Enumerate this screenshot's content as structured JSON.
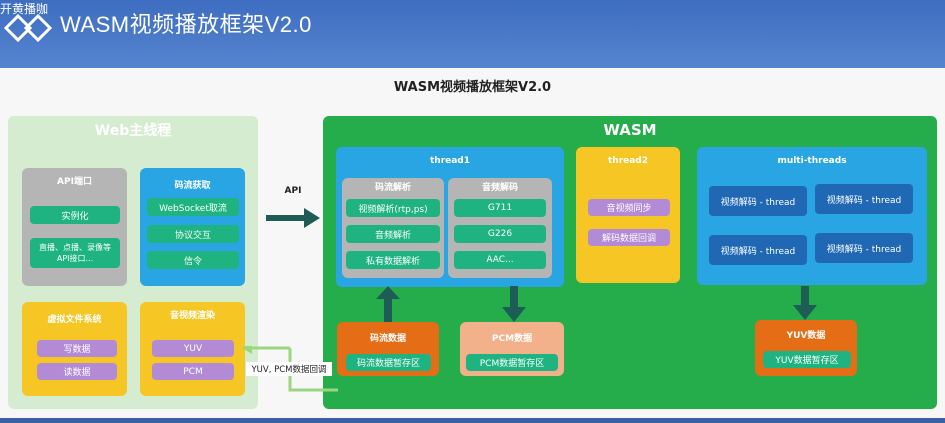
{
  "header": {
    "brand": "开黄播咖",
    "brand_sub": "",
    "title": "WASM视频播放框架V2.0"
  },
  "slide": {
    "title": "WASM视频播放框架V2.0"
  },
  "web": {
    "title": "Web主线程",
    "api_port": {
      "title": "API端口",
      "items": [
        "实例化",
        "直播、点播、录像等API接口..."
      ]
    },
    "stream_get": {
      "title": "码流获取",
      "items": [
        "WebSocket取流",
        "协议交互",
        "信令"
      ]
    },
    "vfs": {
      "title": "虚拟文件系统",
      "items": [
        "写数据",
        "读数据"
      ]
    },
    "render": {
      "title": "音视频渲染",
      "items": [
        "YUV",
        "PCM"
      ]
    }
  },
  "api_arrow_label": "API",
  "feedback_label": "YUV, PCM数据回调",
  "wasm": {
    "title": "WASM",
    "thread1": {
      "title": "thread1",
      "stream_parse": {
        "title": "码流解析",
        "items": [
          "视频解析(rtp,ps)",
          "音频解析",
          "私有数据解析"
        ]
      },
      "audio_decode": {
        "title": "音频解码",
        "items": [
          "G711",
          "G226",
          "AAC..."
        ]
      }
    },
    "thread2": {
      "title": "thread2",
      "items": [
        "音视频同步",
        "解码数据回调"
      ]
    },
    "multi": {
      "title": "multi-threads",
      "items": [
        "视频解码 - thread",
        "视频解码 - thread",
        "视频解码 - thread",
        "视频解码 - thread"
      ]
    },
    "stream_data": {
      "title": "码流数据",
      "item": "码流数据暂存区"
    },
    "pcm_data": {
      "title": "PCM数据",
      "item": "PCM数据暂存区"
    },
    "yuv_data": {
      "title": "YUV数据",
      "item": "YUV数据暂存区"
    }
  },
  "colors": {
    "header_bg": "#4a78c4",
    "web_bg": "#d6ecd0",
    "wasm_bg": "#24ad4a",
    "thread_blue": "#2aa5e3",
    "thread2_yellow": "#f5c624",
    "arrow": "#1e5d55",
    "item_teal": "#1eb381",
    "item_purple": "#b28ad6",
    "data_orange": "#e56d16",
    "pcm_salmon": "#f2b18a",
    "thread_navy": "#2068b4"
  },
  "icons": [
    "brand-logo-icon",
    "api-arrow-icon",
    "up-arrow-icon",
    "down-arrow-icon"
  ]
}
